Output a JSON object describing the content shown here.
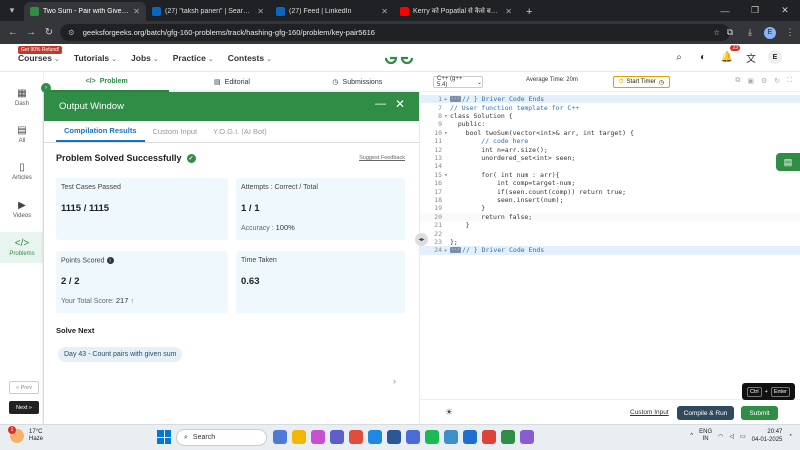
{
  "browser": {
    "tabs": [
      {
        "title": "Two Sum - Pair with Given Sum",
        "favicon_color": "#2f8d46",
        "active": true
      },
      {
        "title": "(27) \"taksh paneri\" | Search | Li",
        "favicon_color": "#0a66c2",
        "active": false
      },
      {
        "title": "(27) Feed | LinkedIn",
        "favicon_color": "#0a66c2",
        "active": false
      },
      {
        "title": "Kerry को Popatlal से कैसे बचाएगा",
        "favicon_color": "#ff0000",
        "active": false
      }
    ],
    "url": "geeksforgeeks.org/batch/gfg-160-problems/track/hashing-gfg-160/problem/key-pair5616",
    "profile_initial": "E"
  },
  "header": {
    "promo": "Get 90% Refund!",
    "nav": [
      "Courses",
      "Tutorials",
      "Jobs",
      "Practice",
      "Contests"
    ],
    "notification_count": "23",
    "user_initial": "E"
  },
  "rail": {
    "items": [
      {
        "label": "Dash",
        "icon": "dashboard-icon"
      },
      {
        "label": "All",
        "icon": "grid-icon"
      },
      {
        "label": "Articles",
        "icon": "book-icon"
      },
      {
        "label": "Videos",
        "icon": "video-icon"
      },
      {
        "label": "Problems",
        "icon": "code-icon"
      }
    ],
    "prev": "« Prev",
    "next": "Next »"
  },
  "problem_tabs": [
    "Problem",
    "Editorial",
    "Submissions"
  ],
  "output": {
    "title": "Output Window",
    "tabs": [
      "Compilation Results",
      "Custom Input",
      "Y.O.G.I. (AI Bot)"
    ],
    "status": "Problem Solved Successfully",
    "feedback": "Suggest Feedback",
    "test_cases_label": "Test Cases Passed",
    "test_cases_value": "1115 / 1115",
    "attempts_label": "Attempts : Correct / Total",
    "attempts_value": "1 / 1",
    "accuracy_label": "Accuracy :",
    "accuracy_value": "100%",
    "points_label": "Points Scored",
    "points_value": "2 / 2",
    "total_score_label": "Your Total Score:",
    "total_score_value": "217",
    "time_label": "Time Taken",
    "time_value": "0.63",
    "solve_next_label": "Solve Next",
    "next_problem": "Day 43 - Count pairs with given sum"
  },
  "editor": {
    "language": "C++ (g++ 5.4)",
    "avg_time": "Average Time: 20m",
    "timer_label": "Start Timer",
    "lines": [
      {
        "n": "1",
        "fold": "▸",
        "text": "// } Driver Code Ends",
        "type": "cmt",
        "hl": true,
        "tag": true
      },
      {
        "n": "7",
        "fold": "",
        "text": "// User function template for C++",
        "type": "cmt"
      },
      {
        "n": "8",
        "fold": "▾",
        "text": "class Solution {",
        "type": "kw"
      },
      {
        "n": "9",
        "fold": "",
        "text": "  public:",
        "type": "kw"
      },
      {
        "n": "10",
        "fold": "▾",
        "text": "    bool twoSum(vector<int>& arr, int target) {",
        "type": "kw"
      },
      {
        "n": "11",
        "fold": "",
        "text": "        // code here",
        "type": "cmt"
      },
      {
        "n": "12",
        "fold": "",
        "text": "        int n=arr.size();",
        "type": "kw"
      },
      {
        "n": "13",
        "fold": "",
        "text": "        unordered_set<int> seen;",
        "type": "kw"
      },
      {
        "n": "14",
        "fold": "",
        "text": "",
        "type": "kw"
      },
      {
        "n": "15",
        "fold": "▾",
        "text": "        for( int num : arr){",
        "type": "kw"
      },
      {
        "n": "16",
        "fold": "",
        "text": "            int comp=target-num;",
        "type": "kw"
      },
      {
        "n": "17",
        "fold": "",
        "text": "            if(seen.count(comp)) return true;",
        "type": "kw"
      },
      {
        "n": "18",
        "fold": "",
        "text": "            seen.insert(num);",
        "type": "kw"
      },
      {
        "n": "19",
        "fold": "",
        "text": "        }",
        "type": "kw"
      },
      {
        "n": "20",
        "fold": "",
        "text": "        return false;",
        "type": "kw",
        "cur": true
      },
      {
        "n": "21",
        "fold": "",
        "text": "    }",
        "type": "kw"
      },
      {
        "n": "22",
        "fold": "",
        "text": "",
        "type": "kw"
      },
      {
        "n": "23",
        "fold": "",
        "text": "};",
        "type": "kw"
      },
      {
        "n": "24",
        "fold": "▸",
        "text": "// } Driver Code Ends",
        "type": "cmt",
        "hl": true,
        "tag": true
      }
    ],
    "custom_input": "Custom Input",
    "compile_run": "Compile & Run",
    "submit": "Submit",
    "shortcut_key1": "Ctrl",
    "shortcut_plus": "+",
    "shortcut_key2": "Enter"
  },
  "taskbar": {
    "weather_badge": "1",
    "temp": "17°C",
    "condition": "Haze",
    "search": "Search",
    "lang_line1": "ENG",
    "lang_line2": "IN",
    "time": "20:47",
    "date": "04-01-2025",
    "app_colors": [
      "#4e7bd6",
      "#f2b705",
      "#c94fd1",
      "#5b5fc7",
      "#e04d3c",
      "#1e88e5",
      "#2b5797",
      "#4a6bd8",
      "#1db954",
      "#3c8fc9",
      "#1f6fd1",
      "#db4437",
      "#2f8d46",
      "#8a5cd1"
    ]
  },
  "colors": {
    "gfg_green": "#2f8d46",
    "card_bg": "#eef8fd",
    "link_blue": "#1a73b8"
  }
}
